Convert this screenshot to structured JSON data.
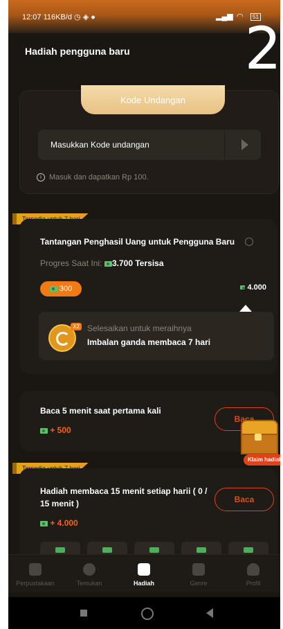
{
  "status": {
    "time": "12:07",
    "speed": "116KB/d",
    "battery": "51"
  },
  "overlay": {
    "number": "2"
  },
  "page": {
    "title": "Hadiah pengguna baru"
  },
  "invite": {
    "tab_label": "Kode Undangan",
    "input_placeholder": "Masukkan Kode undangan",
    "note": "Masuk dan dapatkan Rp 100."
  },
  "challenge": {
    "ribbon": "Tersedia untuk 7 hari",
    "title": "Tantangan Penghasil Uang untuk Pengguna Baru",
    "progress_label": "Progres Saat Ini:",
    "progress_value": "3.700 Tersisa",
    "current": "300",
    "target": "4.000",
    "double_tag": "X2",
    "inner_line1": "Selesaikan untuk meraihnya",
    "inner_line2": "Imbalan ganda membaca 7 hari"
  },
  "task1": {
    "title": "Baca 5 menit saat pertama kali",
    "reward": "+ 500",
    "button": "Baca"
  },
  "chest": {
    "label": "Klaim hadiah"
  },
  "task2": {
    "ribbon": "Tersedia untuk 7 hari",
    "title": "Hadiah membaca 15 menit setiap harii ( 0 / 15 menit )",
    "reward": "+ 4.000",
    "button": "Baca"
  },
  "tabs": [
    {
      "label": "Perpustakaan",
      "icon": "library-icon"
    },
    {
      "label": "Temukan",
      "icon": "compass-icon"
    },
    {
      "label": "Hadiah",
      "icon": "gift-icon"
    },
    {
      "label": "Genre",
      "icon": "grid-icon"
    },
    {
      "label": "Profil",
      "icon": "user-icon"
    }
  ],
  "colors": {
    "accent": "#f07a16",
    "red": "#e2421a",
    "gold": "#e3a21a",
    "background": "#1a1612"
  }
}
